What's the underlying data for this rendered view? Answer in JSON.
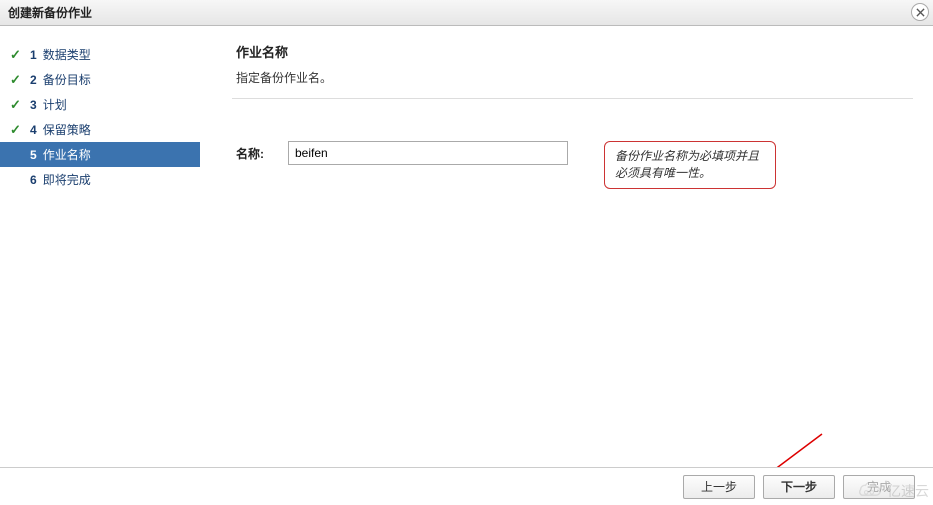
{
  "dialog": {
    "title": "创建新备份作业"
  },
  "steps": [
    {
      "num": "1",
      "label": "数据类型",
      "state": "done"
    },
    {
      "num": "2",
      "label": "备份目标",
      "state": "done"
    },
    {
      "num": "3",
      "label": "计划",
      "state": "done"
    },
    {
      "num": "4",
      "label": "保留策略",
      "state": "done"
    },
    {
      "num": "5",
      "label": "作业名称",
      "state": "current"
    },
    {
      "num": "6",
      "label": "即将完成",
      "state": "pending"
    }
  ],
  "main": {
    "heading": "作业名称",
    "subheading": "指定备份作业名。",
    "name_label": "名称:",
    "name_value": "beifen",
    "hint": "备份作业名称为必填项并且必须具有唯一性。"
  },
  "footer": {
    "back": "上一步",
    "next": "下一步",
    "finish": "完成"
  },
  "watermark": "亿速云"
}
